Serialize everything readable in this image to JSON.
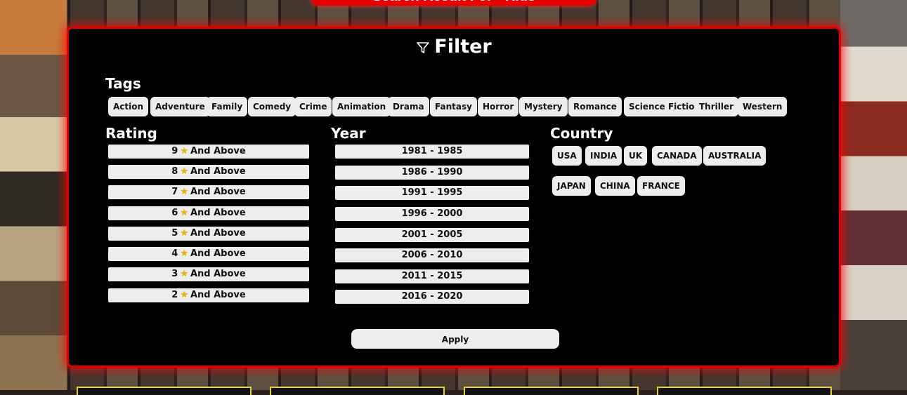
{
  "header": {
    "banner_text": "Search Result For - Kids"
  },
  "filter": {
    "title": "Filter",
    "icon": "filter-icon",
    "tags_label": "Tags",
    "tags": [
      "Action",
      "Adventure",
      "Family",
      "Comedy",
      "Crime",
      "Animation",
      "Drama",
      "Fantasy",
      "Horror",
      "Mystery",
      "Romance",
      "Science Fiction",
      "Thriller",
      "Western"
    ],
    "rating_label": "Rating",
    "ratings": [
      {
        "value": "9",
        "suffix": "And Above"
      },
      {
        "value": "8",
        "suffix": "And Above"
      },
      {
        "value": "7",
        "suffix": "And Above"
      },
      {
        "value": "6",
        "suffix": "And Above"
      },
      {
        "value": "5",
        "suffix": "And Above"
      },
      {
        "value": "4",
        "suffix": "And Above"
      },
      {
        "value": "3",
        "suffix": "And Above"
      },
      {
        "value": "2",
        "suffix": "And Above"
      }
    ],
    "year_label": "Year",
    "years": [
      "1981 - 1985",
      "1986 - 1990",
      "1991 - 1995",
      "1996 - 2000",
      "2001 - 2005",
      "2006 - 2010",
      "2011 - 2015",
      "2016 - 2020"
    ],
    "country_label": "Country",
    "countries": [
      "USA",
      "INDIA",
      "UK",
      "CANADA",
      "AUSTRALIA",
      "JAPAN",
      "CHINA",
      "FRANCE"
    ],
    "apply_label": "Apply"
  },
  "colors": {
    "accent": "#e10000",
    "panel": "#000000",
    "chip": "#ededed",
    "star": "#f0b400",
    "card_border": "#e5d230"
  }
}
